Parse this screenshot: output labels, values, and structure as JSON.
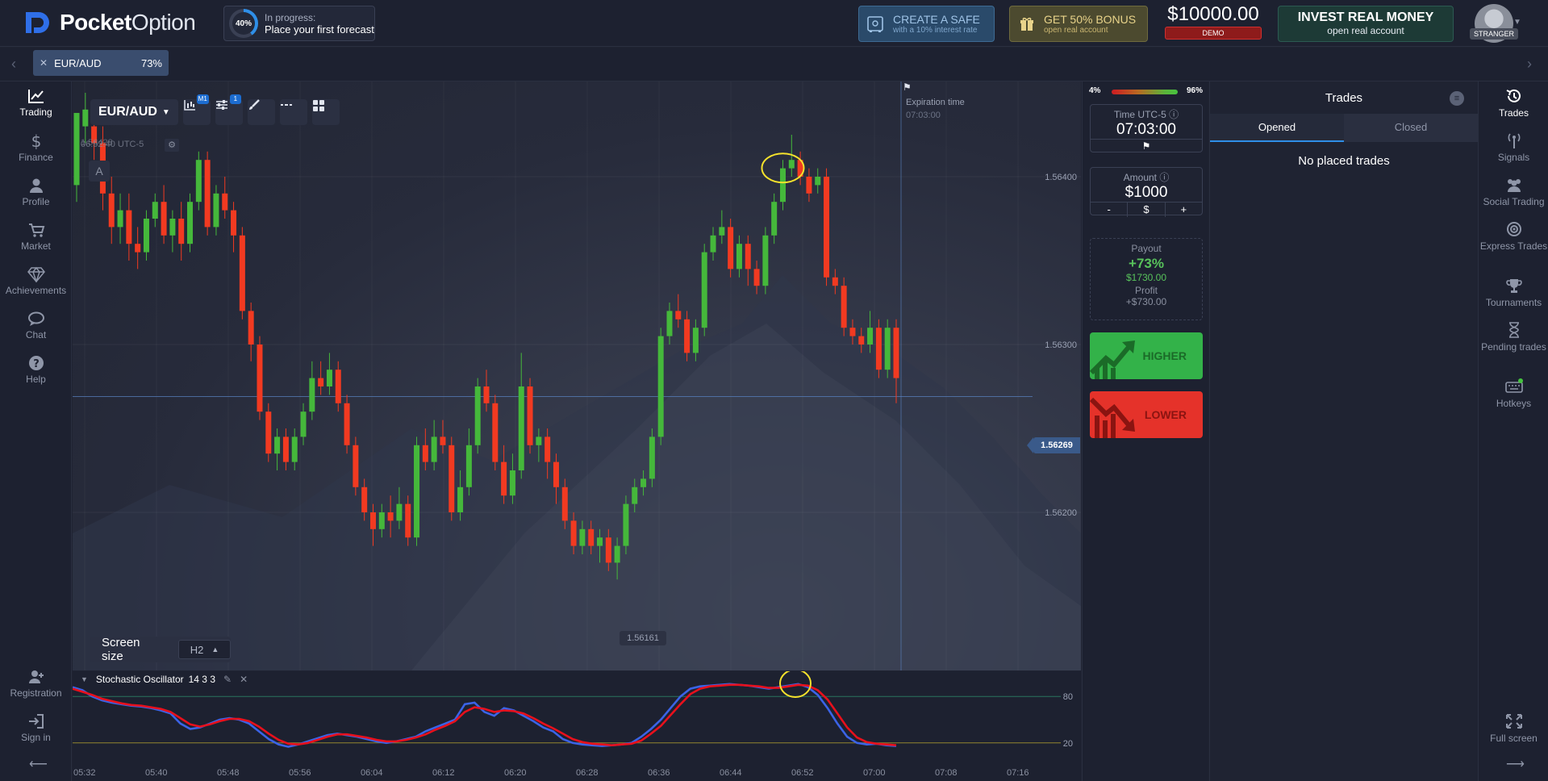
{
  "brand": {
    "name_bold": "Pocket",
    "name_thin": "Option"
  },
  "progress": {
    "percent_label": "40%",
    "percent": 40,
    "status": "In progress:",
    "message": "Place your first forecast"
  },
  "header": {
    "safe": {
      "title": "CREATE A SAFE",
      "subtitle": "with a 10% interest rate"
    },
    "bonus": {
      "title": "GET 50% BONUS",
      "subtitle": "open real account"
    },
    "balance": {
      "amount": "$10000.00",
      "mode": "DEMO"
    },
    "invest": {
      "title": "INVEST REAL MONEY",
      "subtitle": "open real account"
    },
    "user": {
      "label": "STRANGER"
    }
  },
  "asset_tab": {
    "pair": "EUR/AUD",
    "payout": "73%"
  },
  "left_nav": [
    {
      "label": "Trading",
      "icon": "chart-line-icon",
      "active": true
    },
    {
      "label": "Finance",
      "icon": "dollar-icon"
    },
    {
      "label": "Profile",
      "icon": "user-icon"
    },
    {
      "label": "Market",
      "icon": "cart-icon"
    },
    {
      "label": "Achievements",
      "icon": "diamond-icon"
    },
    {
      "label": "Chat",
      "icon": "chat-icon"
    },
    {
      "label": "Help",
      "icon": "help-icon"
    }
  ],
  "left_nav_bottom": [
    {
      "label": "Registration",
      "icon": "user-plus-icon"
    },
    {
      "label": "Sign in",
      "icon": "sign-in-icon"
    }
  ],
  "chart": {
    "pair": "EUR/AUD",
    "timeframe_badge": "M1",
    "indicator_badge": "1",
    "clock": "06:52:40 UTC-5",
    "corner_price": "1.56428",
    "a_button": "A",
    "expiration_label": "Expiration time",
    "expiration_time": "07:03:00",
    "current_price": "1.56269",
    "low_label": "1.56161",
    "y_ticks": [
      "1.56400",
      "1.56300",
      "1.56200"
    ],
    "screen_size_label": "Screen size",
    "screen_size_value": "H2"
  },
  "chart_data": {
    "type": "candlestick",
    "y_unit": "price",
    "candles": [
      [
        1.56395,
        1.56438,
        1.56438,
        1.56385
      ],
      [
        1.5643,
        1.5644,
        1.5645,
        1.5642
      ],
      [
        1.5643,
        1.5642,
        1.56445,
        1.5641
      ],
      [
        1.5642,
        1.5639,
        1.5643,
        1.5638
      ],
      [
        1.5639,
        1.5637,
        1.564,
        1.5636
      ],
      [
        1.5637,
        1.5638,
        1.5639,
        1.5636
      ],
      [
        1.5638,
        1.5636,
        1.5639,
        1.5635
      ],
      [
        1.5636,
        1.56355,
        1.5637,
        1.56345
      ],
      [
        1.56355,
        1.56375,
        1.5638,
        1.5635
      ],
      [
        1.56375,
        1.56385,
        1.5639,
        1.5637
      ],
      [
        1.56385,
        1.56365,
        1.56395,
        1.5636
      ],
      [
        1.56365,
        1.56375,
        1.5638,
        1.56355
      ],
      [
        1.56375,
        1.5636,
        1.56385,
        1.5635
      ],
      [
        1.5636,
        1.56385,
        1.5639,
        1.56355
      ],
      [
        1.56385,
        1.5641,
        1.56415,
        1.5638
      ],
      [
        1.5641,
        1.5637,
        1.56415,
        1.56365
      ],
      [
        1.5637,
        1.5639,
        1.56395,
        1.56365
      ],
      [
        1.5639,
        1.5638,
        1.564,
        1.56375
      ],
      [
        1.5638,
        1.56365,
        1.56385,
        1.56355
      ],
      [
        1.56365,
        1.5632,
        1.5637,
        1.56315
      ],
      [
        1.5632,
        1.563,
        1.56325,
        1.5629
      ],
      [
        1.563,
        1.5626,
        1.56305,
        1.56255
      ],
      [
        1.5626,
        1.56235,
        1.56265,
        1.5623
      ],
      [
        1.56235,
        1.56245,
        1.5625,
        1.56225
      ],
      [
        1.56245,
        1.5623,
        1.5625,
        1.56225
      ],
      [
        1.5623,
        1.56245,
        1.5625,
        1.56225
      ],
      [
        1.56245,
        1.5626,
        1.56265,
        1.5624
      ],
      [
        1.5626,
        1.5628,
        1.5629,
        1.56255
      ],
      [
        1.5628,
        1.56275,
        1.5629,
        1.5627
      ],
      [
        1.56275,
        1.56285,
        1.56295,
        1.5627
      ],
      [
        1.56285,
        1.56265,
        1.5629,
        1.5626
      ],
      [
        1.56265,
        1.5624,
        1.5627,
        1.56235
      ],
      [
        1.5624,
        1.56215,
        1.56245,
        1.5621
      ],
      [
        1.56215,
        1.562,
        1.5622,
        1.56195
      ],
      [
        1.562,
        1.5619,
        1.56205,
        1.5618
      ],
      [
        1.5619,
        1.562,
        1.56205,
        1.56185
      ],
      [
        1.562,
        1.56195,
        1.5621,
        1.56185
      ],
      [
        1.56195,
        1.56205,
        1.56215,
        1.5619
      ],
      [
        1.56205,
        1.56185,
        1.5621,
        1.5618
      ],
      [
        1.56185,
        1.5624,
        1.56245,
        1.5618
      ],
      [
        1.5624,
        1.5623,
        1.5625,
        1.56225
      ],
      [
        1.5623,
        1.56245,
        1.56255,
        1.56225
      ],
      [
        1.56245,
        1.5624,
        1.56255,
        1.56235
      ],
      [
        1.5624,
        1.562,
        1.56245,
        1.56195
      ],
      [
        1.562,
        1.56215,
        1.56225,
        1.56195
      ],
      [
        1.56215,
        1.5624,
        1.5625,
        1.5621
      ],
      [
        1.5624,
        1.56275,
        1.5628,
        1.56235
      ],
      [
        1.56275,
        1.56265,
        1.56285,
        1.5626
      ],
      [
        1.56265,
        1.5623,
        1.5627,
        1.56225
      ],
      [
        1.5623,
        1.5621,
        1.5624,
        1.56205
      ],
      [
        1.5621,
        1.56225,
        1.56235,
        1.56205
      ],
      [
        1.56225,
        1.56275,
        1.56295,
        1.5622
      ],
      [
        1.56275,
        1.5624,
        1.5628,
        1.56235
      ],
      [
        1.5624,
        1.56245,
        1.5625,
        1.5623
      ],
      [
        1.56245,
        1.5623,
        1.5625,
        1.5622
      ],
      [
        1.5623,
        1.56215,
        1.56235,
        1.56205
      ],
      [
        1.56215,
        1.56195,
        1.5622,
        1.5619
      ],
      [
        1.56195,
        1.5618,
        1.562,
        1.56175
      ],
      [
        1.5618,
        1.5619,
        1.56195,
        1.56175
      ],
      [
        1.5619,
        1.5618,
        1.56195,
        1.56175
      ],
      [
        1.5618,
        1.56185,
        1.5619,
        1.5617
      ],
      [
        1.56185,
        1.5617,
        1.5619,
        1.56165
      ],
      [
        1.5617,
        1.5618,
        1.56185,
        1.5616
      ],
      [
        1.5618,
        1.56205,
        1.5621,
        1.56175
      ],
      [
        1.56205,
        1.56215,
        1.5622,
        1.562
      ],
      [
        1.56215,
        1.5622,
        1.56225,
        1.5621
      ],
      [
        1.5622,
        1.56245,
        1.5625,
        1.56215
      ],
      [
        1.56245,
        1.56305,
        1.5631,
        1.5624
      ],
      [
        1.56305,
        1.5632,
        1.56325,
        1.563
      ],
      [
        1.5632,
        1.56315,
        1.5633,
        1.5631
      ],
      [
        1.56315,
        1.56295,
        1.5632,
        1.5629
      ],
      [
        1.56295,
        1.5631,
        1.56315,
        1.5629
      ],
      [
        1.5631,
        1.56355,
        1.5636,
        1.56305
      ],
      [
        1.56355,
        1.56365,
        1.5637,
        1.5635
      ],
      [
        1.56365,
        1.5637,
        1.5638,
        1.5636
      ],
      [
        1.5637,
        1.56345,
        1.56375,
        1.5634
      ],
      [
        1.56345,
        1.5636,
        1.56365,
        1.5634
      ],
      [
        1.5636,
        1.56345,
        1.56365,
        1.56335
      ],
      [
        1.56345,
        1.56335,
        1.5635,
        1.5633
      ],
      [
        1.56335,
        1.56365,
        1.5637,
        1.5633
      ],
      [
        1.56365,
        1.56385,
        1.5639,
        1.5636
      ],
      [
        1.56385,
        1.56405,
        1.5641,
        1.5638
      ],
      [
        1.56405,
        1.5641,
        1.56425,
        1.564
      ],
      [
        1.5641,
        1.564,
        1.56415,
        1.56395
      ],
      [
        1.564,
        1.5639,
        1.56405,
        1.56385
      ],
      [
        1.56395,
        1.564,
        1.56405,
        1.5639
      ],
      [
        1.564,
        1.5634,
        1.56405,
        1.56335
      ],
      [
        1.5634,
        1.56335,
        1.56345,
        1.5633
      ],
      [
        1.56335,
        1.5631,
        1.5634,
        1.56305
      ],
      [
        1.5631,
        1.56305,
        1.56315,
        1.563
      ],
      [
        1.56305,
        1.563,
        1.5631,
        1.56295
      ],
      [
        1.563,
        1.5631,
        1.5632,
        1.56295
      ],
      [
        1.5631,
        1.56285,
        1.56315,
        1.5628
      ],
      [
        1.56285,
        1.5631,
        1.56315,
        1.5628
      ],
      [
        1.5631,
        1.5628,
        1.56315,
        1.56265
      ]
    ],
    "oscillator": {
      "name": "Stochastic Oscillator",
      "params": "14 3 3",
      "levels": [
        80,
        20
      ],
      "k_line": [
        92,
        88,
        80,
        75,
        72,
        70,
        68,
        67,
        65,
        62,
        58,
        45,
        38,
        40,
        45,
        50,
        52,
        50,
        45,
        35,
        25,
        18,
        15,
        18,
        22,
        26,
        30,
        32,
        30,
        28,
        25,
        22,
        20,
        22,
        25,
        28,
        35,
        40,
        45,
        50,
        70,
        72,
        60,
        55,
        65,
        62,
        55,
        48,
        40,
        35,
        25,
        20,
        18,
        17,
        16,
        17,
        18,
        20,
        28,
        38,
        50,
        65,
        80,
        90,
        93,
        94,
        95,
        96,
        95,
        94,
        92,
        90,
        92,
        94,
        96,
        92,
        82,
        65,
        45,
        28,
        20,
        18,
        19,
        17,
        16
      ],
      "d_line": [
        90,
        86,
        82,
        77,
        74,
        71,
        69,
        68,
        66,
        64,
        60,
        52,
        44,
        41,
        44,
        48,
        51,
        51,
        48,
        41,
        32,
        24,
        19,
        18,
        20,
        24,
        28,
        31,
        31,
        29,
        27,
        24,
        22,
        22,
        24,
        27,
        31,
        37,
        42,
        48,
        60,
        66,
        64,
        60,
        62,
        61,
        58,
        52,
        45,
        39,
        32,
        25,
        21,
        19,
        18,
        17,
        18,
        19,
        23,
        32,
        42,
        56,
        70,
        83,
        90,
        93,
        94,
        95,
        95,
        94,
        93,
        91,
        91,
        93,
        95,
        94,
        88,
        76,
        58,
        40,
        27,
        21,
        19,
        18,
        17
      ]
    },
    "x_ticks": [
      "05:32",
      "05:40",
      "05:48",
      "05:56",
      "06:04",
      "06:12",
      "06:20",
      "06:28",
      "06:36",
      "06:44",
      "06:52",
      "07:00",
      "07:08",
      "07:16"
    ]
  },
  "trade_panel": {
    "sentiment_low": "4%",
    "sentiment_high": "96%",
    "sentiment_value": 96,
    "time_caption": "Time UTC-5",
    "time_value": "07:03:00",
    "amount_caption": "Amount",
    "amount_value": "$1000",
    "minus": "-",
    "currency": "$",
    "plus": "+",
    "payout_caption": "Payout",
    "payout_pct": "+73%",
    "payout_usd": "$1730.00",
    "profit_caption": "Profit",
    "profit_value": "+$730.00",
    "higher": "HIGHER",
    "lower": "LOWER"
  },
  "trades": {
    "title": "Trades",
    "tabs": [
      "Opened",
      "Closed"
    ],
    "empty": "No placed trades"
  },
  "right_nav": [
    {
      "label": "Trades",
      "icon": "history-icon",
      "active": true
    },
    {
      "label": "Signals",
      "icon": "signal-icon"
    },
    {
      "label": "Social Trading",
      "icon": "people-icon"
    },
    {
      "label": "Express Trades",
      "icon": "target-icon"
    },
    {
      "label": "Tournaments",
      "icon": "trophy-icon"
    },
    {
      "label": "Pending trades",
      "icon": "hourglass-icon"
    },
    {
      "label": "Hotkeys",
      "icon": "keyboard-icon"
    }
  ],
  "right_nav_bottom": {
    "label": "Full screen",
    "icon": "fullscreen-icon"
  },
  "colors": {
    "bull": "#45b83b",
    "bear": "#f23a21",
    "k_line": "#3b63e6",
    "d_line": "#e8101c",
    "accent": "#2f8fe8"
  }
}
